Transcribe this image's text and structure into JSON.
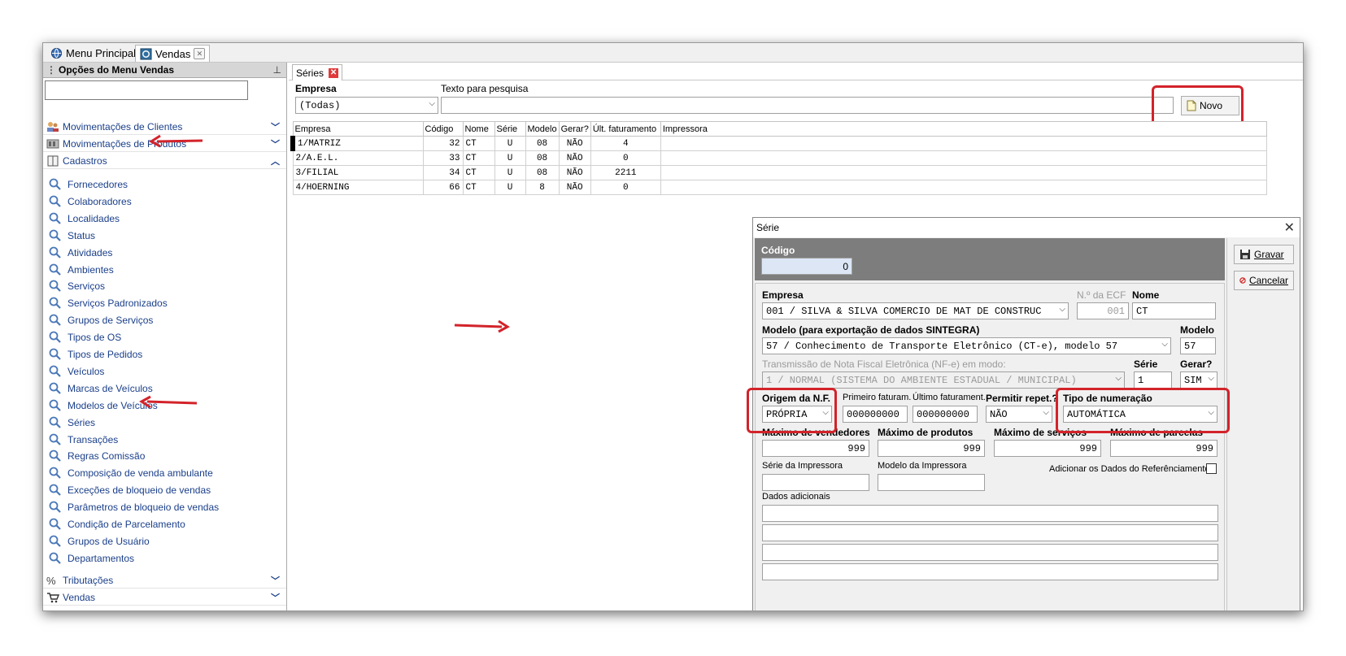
{
  "tabs": [
    {
      "label": "Menu Principal"
    },
    {
      "label": "Vendas"
    }
  ],
  "sidebar": {
    "title": "Opções do Menu Vendas",
    "pin": "卆",
    "groups": [
      {
        "label": "Movimentações de Clientes"
      },
      {
        "label": "Movimentações de Produtos"
      },
      {
        "label": "Cadastros"
      },
      {
        "label": "Tributações"
      },
      {
        "label": "Vendas"
      }
    ],
    "items": [
      "Fornecedores",
      "Colaboradores",
      "Localidades",
      "Status",
      "Atividades",
      "Ambientes",
      "Serviços",
      "Serviços Padronizados",
      "Grupos de Serviços",
      "Tipos de OS",
      "Tipos de Pedidos",
      "Veículos",
      "Marcas de Veículos",
      "Modelos de Veículos",
      "Séries",
      "Transações",
      "Regras Comissão",
      "Composição de venda ambulante",
      "Exceções de bloqueio de vendas",
      "Parâmetros de bloqueio de vendas",
      "Condição de Parcelamento",
      "Grupos de Usuário",
      "Departamentos"
    ]
  },
  "main": {
    "tab": "Séries",
    "empresa_label": "Empresa",
    "empresa_value": "(Todas)",
    "pesquisa_label": "Texto para pesquisa",
    "novo_label": "Novo",
    "columns": [
      "Empresa",
      "Código",
      "Nome",
      "Série",
      "Modelo",
      "Gerar?",
      "Últ. faturamento",
      "Impressora"
    ],
    "rows": [
      [
        "1/MATRIZ",
        "32",
        "CT",
        "U",
        "08",
        "NÃO",
        "4",
        ""
      ],
      [
        "2/A.E.L.",
        "33",
        "CT",
        "U",
        "08",
        "NÃO",
        "0",
        ""
      ],
      [
        "3/FILIAL",
        "34",
        "CT",
        "U",
        "08",
        "NÃO",
        "2211",
        ""
      ],
      [
        "4/HOERNING",
        "66",
        "CT",
        "U",
        "8",
        "NÃO",
        "0",
        ""
      ]
    ]
  },
  "dialog": {
    "title": "Série",
    "close": "✕",
    "codigo_label": "Código",
    "codigo_value": "0",
    "gravar": "Gravar",
    "cancelar": "Cancelar",
    "empresa_label": "Empresa",
    "empresa_value": "001 / SILVA & SILVA COMERCIO DE MAT DE CONSTRUC",
    "ecf_label": "N.º da ECF",
    "ecf_value": "001",
    "nome_label": "Nome",
    "nome_value": "CT",
    "modelo_sint_label": "Modelo (para exportação de dados SINTEGRA)",
    "modelo_sint_value": "57 / Conhecimento de Transporte Eletrônico (CT-e), modelo 57",
    "modelo_label": "Modelo",
    "modelo_value": "57",
    "transm_label": "Transmissão de Nota Fiscal Eletrônica (NF-e) em modo:",
    "transm_value": "1 / NORMAL (SISTEMA DO AMBIENTE ESTADUAL / MUNICIPAL)",
    "serie_label": "Série",
    "serie_value": "1",
    "gerar_label": "Gerar?",
    "gerar_value": "SIM",
    "origem_label": "Origem da N.F.",
    "origem_value": "PRÓPRIA",
    "primeiro_label": "Primeiro faturam.",
    "primeiro_value": "000000000",
    "ultimo_label": "Último faturament.",
    "ultimo_value": "000000000",
    "permitir_label": "Permitir repet.?",
    "permitir_value": "NÃO",
    "tipo_label": "Tipo de numeração",
    "tipo_value": "AUTOMÁTICA",
    "max_vend_label": "Máximo de vendedores",
    "max_vend_value": "999",
    "max_prod_label": "Máximo de produtos",
    "max_prod_value": "999",
    "max_serv_label": "Máximo de serviços",
    "max_serv_value": "999",
    "max_parc_label": "Máximo de parcelas",
    "max_parc_value": "999",
    "serie_imp_label": "Série da Impressora",
    "modelo_imp_label": "Modelo da Impressora",
    "adicionar_label": "Adicionar os Dados do Referênciamento",
    "dados_label": "Dados adicionais"
  },
  "colors": {
    "highlight": "#d3232a",
    "link": "#1a3f8a"
  }
}
